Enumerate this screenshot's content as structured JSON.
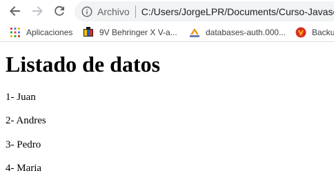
{
  "browser": {
    "omnibox": {
      "security_label": "Archivo",
      "url": "C:/Users/JorgeLPR/Documents/Curso-Javascr"
    },
    "bookmarks": [
      {
        "label": "Aplicaciones",
        "icon": "apps-grid-icon"
      },
      {
        "label": "9V Behringer X V-a...",
        "icon": "behringer-favicon-icon"
      },
      {
        "label": "databases-auth.000...",
        "icon": "phpmyadmin-favicon-icon"
      },
      {
        "label": "Backu",
        "icon": "backup-favicon-icon"
      }
    ]
  },
  "page": {
    "title": "Listado de datos",
    "items": [
      "1- Juan",
      "2- Andres",
      "3- Pedro",
      "4- Maria"
    ]
  },
  "colors": {
    "icon_gray": "#5f6368",
    "omnibox_bg": "#f1f3f4",
    "text": "#000000"
  }
}
